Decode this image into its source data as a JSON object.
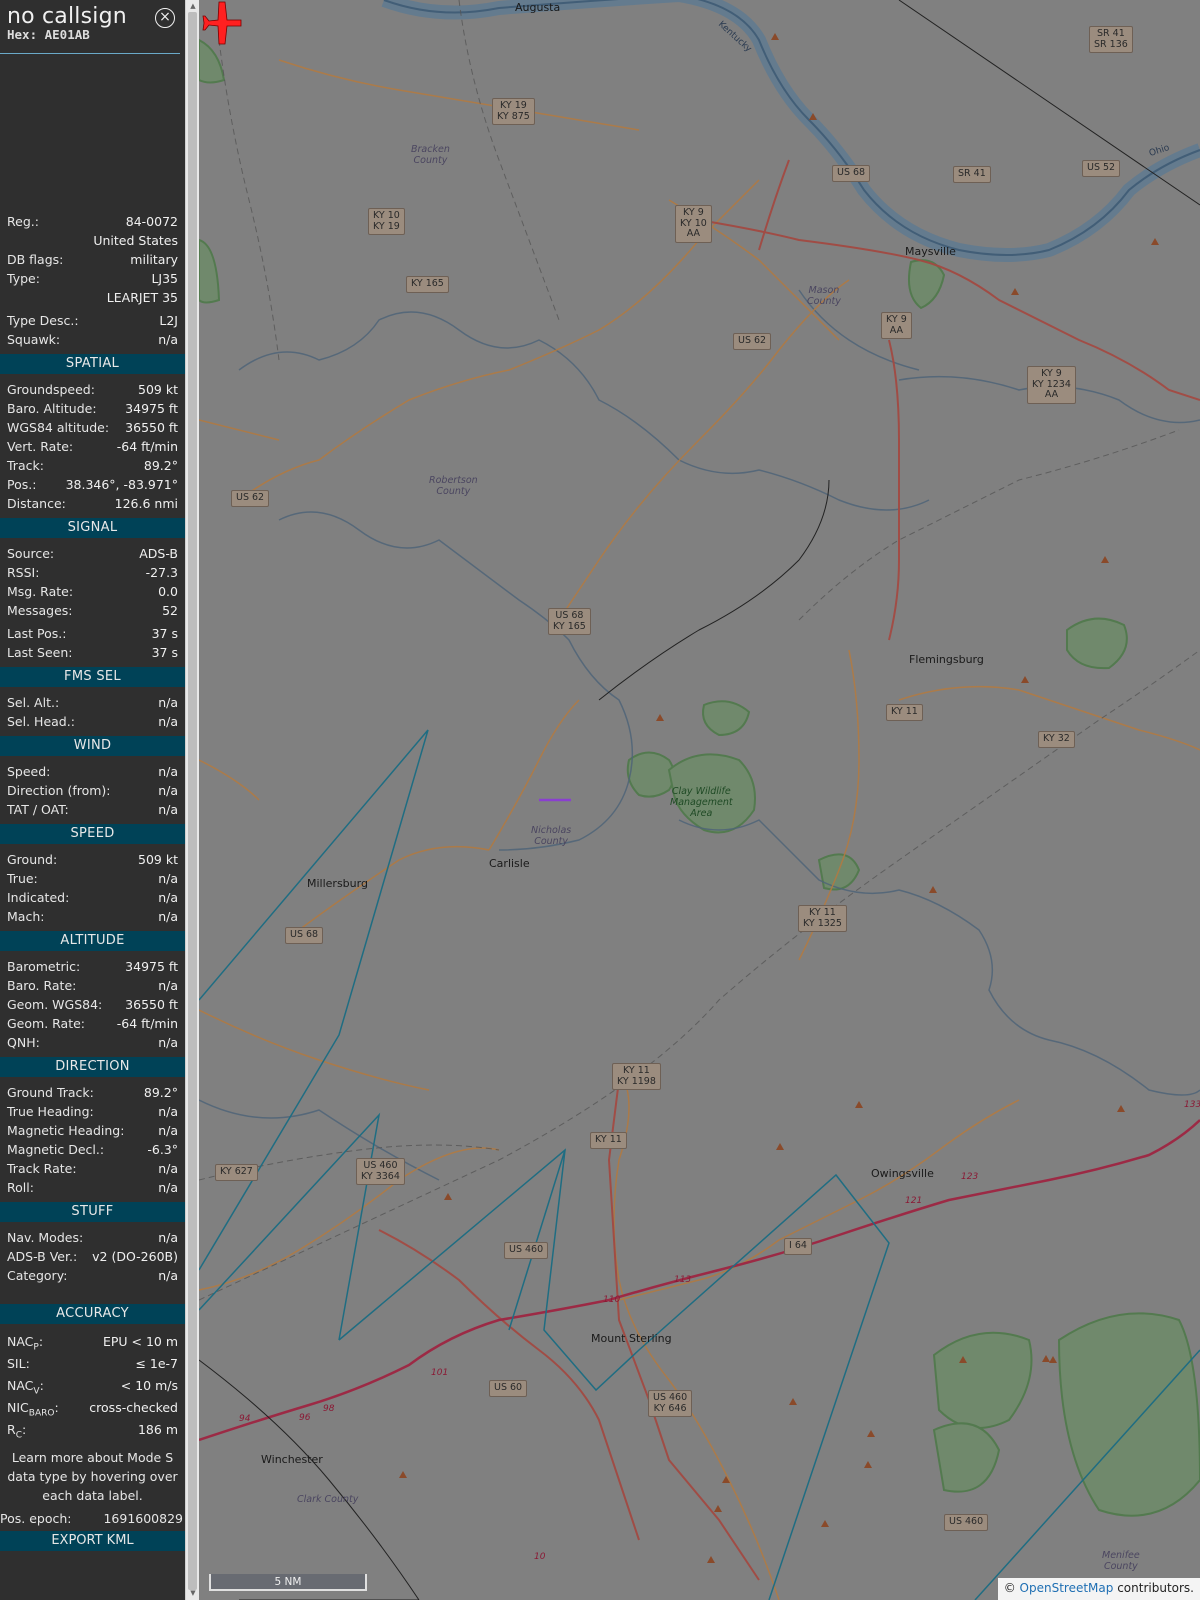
{
  "header": {
    "callsign": "no callsign",
    "hex": "Hex: AE01AB",
    "close_glyph": "×"
  },
  "info": {
    "reg_label": "Reg.:",
    "reg": "84-0072",
    "country": "United States",
    "dbflags_label": "DB flags:",
    "dbflags": "military",
    "type_label": "Type:",
    "type": "LJ35",
    "type_name": "LEARJET 35",
    "typedesc_label": "Type Desc.:",
    "typedesc": "L2J",
    "squawk_label": "Squawk:",
    "squawk": "n/a"
  },
  "spatial": {
    "title": "SPATIAL",
    "rows": [
      {
        "label": "Groundspeed:",
        "value": "509 kt"
      },
      {
        "label": "Baro. Altitude:",
        "value": "34975 ft"
      },
      {
        "label": "WGS84 altitude:",
        "value": "36550 ft"
      },
      {
        "label": "Vert. Rate:",
        "value": "-64 ft/min"
      },
      {
        "label": "Track:",
        "value": "89.2°"
      },
      {
        "label": "Pos.:",
        "value": "38.346°, -83.971°"
      },
      {
        "label": "Distance:",
        "value": "126.6 nmi"
      }
    ]
  },
  "signal": {
    "title": "SIGNAL",
    "rows": [
      {
        "label": "Source:",
        "value": "ADS-B"
      },
      {
        "label": "RSSI:",
        "value": "-27.3"
      },
      {
        "label": "Msg. Rate:",
        "value": "0.0"
      },
      {
        "label": "Messages:",
        "value": "52"
      }
    ],
    "rows2": [
      {
        "label": "Last Pos.:",
        "value": "37 s"
      },
      {
        "label": "Last Seen:",
        "value": "37 s"
      }
    ]
  },
  "fms": {
    "title": "FMS SEL",
    "rows": [
      {
        "label": "Sel. Alt.:",
        "value": "n/a"
      },
      {
        "label": "Sel. Head.:",
        "value": "n/a"
      }
    ]
  },
  "wind": {
    "title": "WIND",
    "rows": [
      {
        "label": "Speed:",
        "value": "n/a"
      },
      {
        "label": "Direction (from):",
        "value": "n/a"
      },
      {
        "label": "TAT / OAT:",
        "value": "n/a"
      }
    ]
  },
  "speed": {
    "title": "SPEED",
    "rows": [
      {
        "label": "Ground:",
        "value": "509 kt"
      },
      {
        "label": "True:",
        "value": "n/a"
      },
      {
        "label": "Indicated:",
        "value": "n/a"
      },
      {
        "label": "Mach:",
        "value": "n/a"
      }
    ]
  },
  "altitude": {
    "title": "ALTITUDE",
    "rows": [
      {
        "label": "Barometric:",
        "value": "34975 ft"
      },
      {
        "label": "Baro. Rate:",
        "value": "n/a"
      },
      {
        "label": "Geom. WGS84:",
        "value": "36550 ft"
      },
      {
        "label": "Geom. Rate:",
        "value": "-64 ft/min"
      },
      {
        "label": "QNH:",
        "value": "n/a"
      }
    ]
  },
  "direction": {
    "title": "DIRECTION",
    "rows": [
      {
        "label": "Ground Track:",
        "value": "89.2°"
      },
      {
        "label": "True Heading:",
        "value": "n/a"
      },
      {
        "label": "Magnetic Heading:",
        "value": "n/a"
      },
      {
        "label": "Magnetic Decl.:",
        "value": "-6.3°"
      },
      {
        "label": "Track Rate:",
        "value": "n/a"
      },
      {
        "label": "Roll:",
        "value": "n/a"
      }
    ]
  },
  "stuff": {
    "title": "STUFF",
    "rows": [
      {
        "label": "Nav. Modes:",
        "value": "n/a"
      },
      {
        "label": "ADS-B Ver.:",
        "value": "v2 (DO-260B)"
      },
      {
        "label": "Category:",
        "value": "n/a"
      }
    ]
  },
  "accuracy": {
    "title": "ACCURACY",
    "nacp_main": "NAC",
    "nacp_sub": "P",
    "nacp_value": "EPU < 10 m",
    "sil_label": "SIL:",
    "sil_value": "≤ 1e-7",
    "nacv_main": "NAC",
    "nacv_sub": "V",
    "nacv_value": "< 10 m/s",
    "nic_main": "NIC",
    "nic_sub": "BARO",
    "nic_value": "cross-checked",
    "rc_main": "R",
    "rc_sub": "C",
    "rc_value": "186 m"
  },
  "footer": {
    "note": "Learn more about Mode S data type by hovering over each data label.",
    "epoch_label": "Pos. epoch:",
    "epoch_value": "1691600829",
    "export": "EXPORT KML"
  },
  "map": {
    "scale": "5 NM",
    "attribution_prefix": "©",
    "attribution_link": "OpenStreetMap",
    "attribution_suffix": "contributors.",
    "places": [
      {
        "id": "augusta",
        "name": "Augusta"
      },
      {
        "id": "maysville",
        "name": "Maysville"
      },
      {
        "id": "flemingsburg",
        "name": "Flemingsburg"
      },
      {
        "id": "carlisle",
        "name": "Carlisle"
      },
      {
        "id": "millersburg",
        "name": "Millersburg"
      },
      {
        "id": "owingsville",
        "name": "Owingsville"
      },
      {
        "id": "mount-sterling",
        "name": "Mount Sterling"
      },
      {
        "id": "winchester",
        "name": "Winchester"
      },
      {
        "id": "kentucky",
        "name": "Kentucky"
      },
      {
        "id": "ohio",
        "name": "Ohio"
      }
    ],
    "counties": [
      {
        "id": "bracken",
        "name": "Bracken\nCounty"
      },
      {
        "id": "mason",
        "name": "Mason\nCounty"
      },
      {
        "id": "robertson",
        "name": "Robertson\nCounty"
      },
      {
        "id": "nicholas",
        "name": "Nicholas\nCounty"
      },
      {
        "id": "clark",
        "name": "Clark County"
      },
      {
        "id": "menifee",
        "name": "Menifee\nCounty"
      },
      {
        "id": "clay",
        "name": "Clay Wildlife\nManagement\nArea"
      }
    ],
    "shields": [
      {
        "id": "ky19-875",
        "text": "KY 19\nKY 875"
      },
      {
        "id": "ky10-19",
        "text": "KY 10\nKY 19"
      },
      {
        "id": "ky165",
        "text": "KY 165"
      },
      {
        "id": "ky9-10-aa",
        "text": "KY 9\nKY 10\nAA"
      },
      {
        "id": "us68-top",
        "text": "US 68"
      },
      {
        "id": "sr41",
        "text": "SR 41"
      },
      {
        "id": "sr41-136",
        "text": "SR 41\nSR 136"
      },
      {
        "id": "us52",
        "text": "US 52"
      },
      {
        "id": "us62-a",
        "text": "US 62"
      },
      {
        "id": "ky9-aa",
        "text": "KY 9\nAA"
      },
      {
        "id": "ky9-1234-aa",
        "text": "KY 9\nKY 1234\nAA"
      },
      {
        "id": "us62-b",
        "text": "US 62"
      },
      {
        "id": "us68-165",
        "text": "US 68\nKY 165"
      },
      {
        "id": "ky11-a",
        "text": "KY 11"
      },
      {
        "id": "ky32",
        "text": "KY 32"
      },
      {
        "id": "us68-b",
        "text": "US 68"
      },
      {
        "id": "ky11-1325",
        "text": "KY 11\nKY 1325"
      },
      {
        "id": "ky11-1198",
        "text": "KY 11\nKY 1198"
      },
      {
        "id": "ky11-b",
        "text": "KY 11"
      },
      {
        "id": "ky627",
        "text": "KY 627"
      },
      {
        "id": "us460-3364",
        "text": "US 460\nKY 3364"
      },
      {
        "id": "us460-a",
        "text": "US 460"
      },
      {
        "id": "i64",
        "text": "I 64"
      },
      {
        "id": "us60",
        "text": "US 60"
      },
      {
        "id": "us460-646",
        "text": "US 460\nKY 646"
      },
      {
        "id": "us460-b",
        "text": "US 460"
      }
    ],
    "exits": [
      "133",
      "123",
      "121",
      "113",
      "110",
      "101",
      "98",
      "96",
      "94",
      "10"
    ]
  }
}
